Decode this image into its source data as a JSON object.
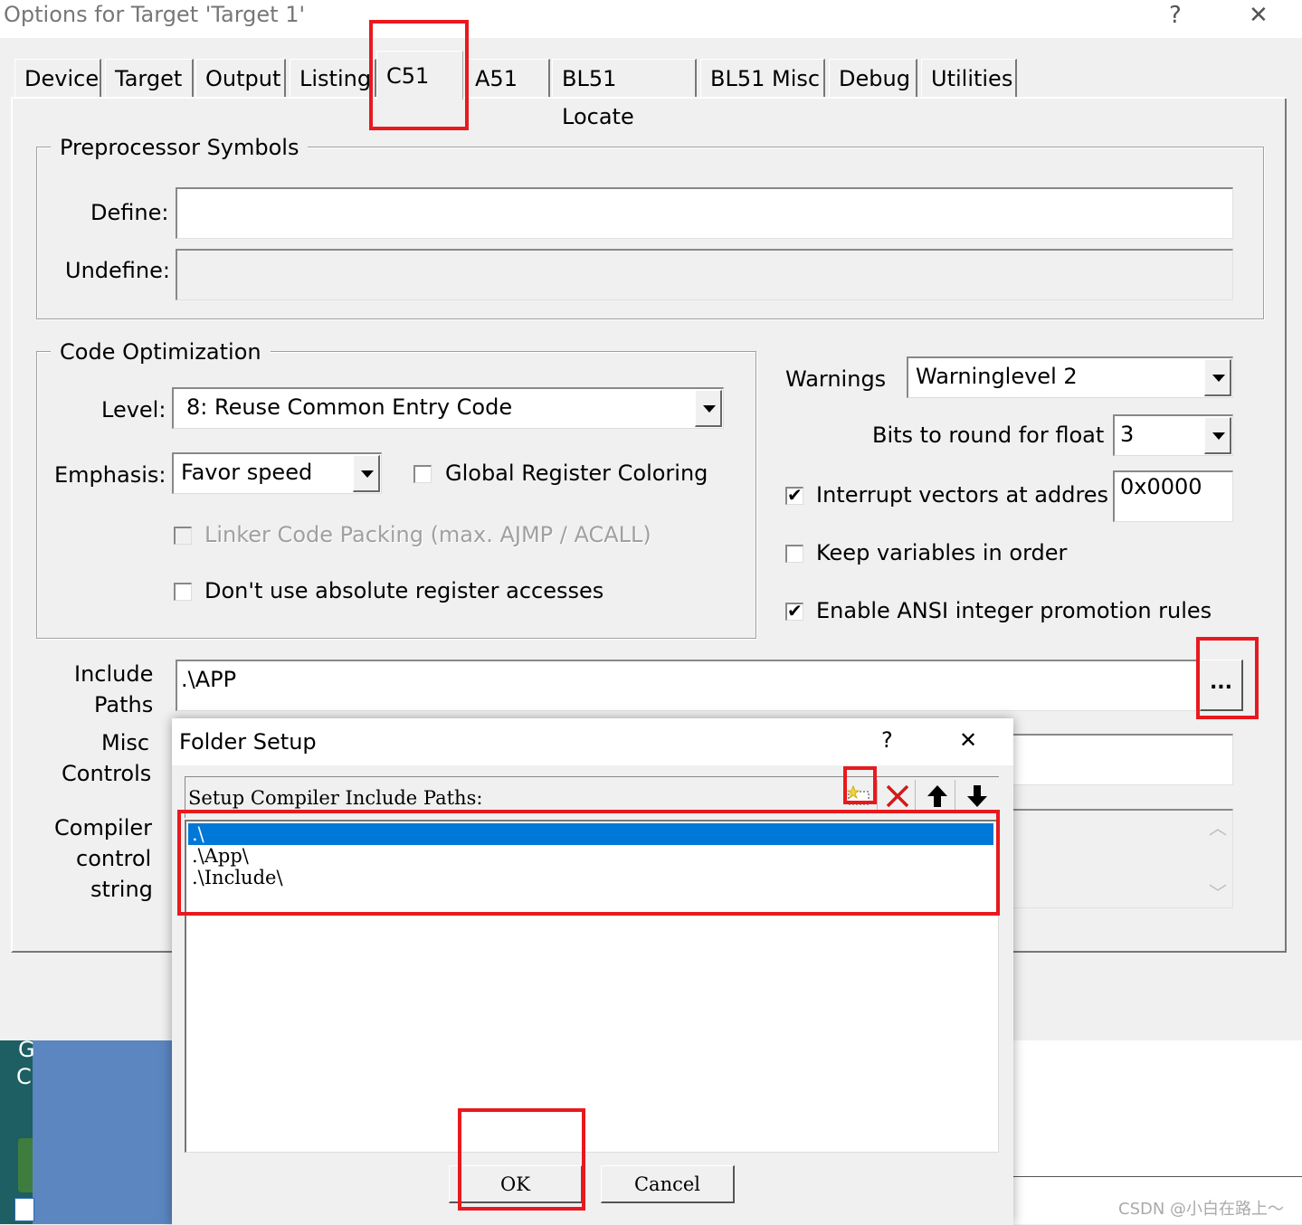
{
  "window": {
    "title": "Options for Target 'Target 1'",
    "help_glyph": "?",
    "close_glyph": "✕"
  },
  "tabs": [
    {
      "label": "Device"
    },
    {
      "label": "Target"
    },
    {
      "label": "Output"
    },
    {
      "label": "Listing"
    },
    {
      "label": "C51"
    },
    {
      "label": "A51"
    },
    {
      "label": "BL51 Locate"
    },
    {
      "label": "BL51 Misc"
    },
    {
      "label": "Debug"
    },
    {
      "label": "Utilities"
    }
  ],
  "active_tab": "C51",
  "preprocessor": {
    "legend": "Preprocessor Symbols",
    "define_label": "Define:",
    "define_value": "",
    "undefine_label": "Undefine:",
    "undefine_value": ""
  },
  "optimization": {
    "legend": "Code Optimization",
    "level_label": "Level:",
    "level_value": "8: Reuse Common Entry Code",
    "emphasis_label": "Emphasis:",
    "emphasis_value": "Favor speed",
    "global_register_coloring": {
      "label": "Global Register Coloring",
      "checked": false
    },
    "linker_code_packing": {
      "label": "Linker Code Packing (max. AJMP / ACALL)",
      "checked": false,
      "disabled": true
    },
    "no_absolute_register": {
      "label": "Don't use absolute register accesses",
      "checked": false
    }
  },
  "warnings": {
    "label": "Warnings",
    "value": "Warninglevel 2",
    "bits_label": "Bits to round for float",
    "bits_value": "3",
    "interrupt_vectors": {
      "label": "Interrupt vectors at addres",
      "checked": true,
      "value": "0x0000"
    },
    "keep_variables": {
      "label": "Keep variables in order",
      "checked": false
    },
    "ansi_promotion": {
      "label": "Enable ANSI integer promotion rules",
      "checked": true
    }
  },
  "include_paths": {
    "label_line1": "Include",
    "label_line2": "Paths",
    "value": ".\\APP",
    "browse_label": "..."
  },
  "misc_controls": {
    "label_line1": "Misc",
    "label_line2": "Controls",
    "value": ""
  },
  "compiler_control": {
    "label_line1": "Compiler",
    "label_line2": "control",
    "label_line3": "string"
  },
  "folder_dialog": {
    "title": "Folder Setup",
    "help_glyph": "?",
    "close_glyph": "✕",
    "list_header": "Setup Compiler Include Paths:",
    "toolbar": [
      "new-folder-icon",
      "delete-icon",
      "move-up-icon",
      "move-down-icon"
    ],
    "paths": [
      ".\\",
      ".\\App\\",
      ".\\Include\\"
    ],
    "selected_index": 0,
    "ok_label": "OK",
    "cancel_label": "Cancel"
  },
  "background_fragments": {
    "text1": "G",
    "text2": "C"
  },
  "watermark": "CSDN @小白在路上～",
  "colors": {
    "highlight_box": "#e8191e",
    "selection": "#0078d7",
    "desktop_blue": "#5b86c0"
  }
}
